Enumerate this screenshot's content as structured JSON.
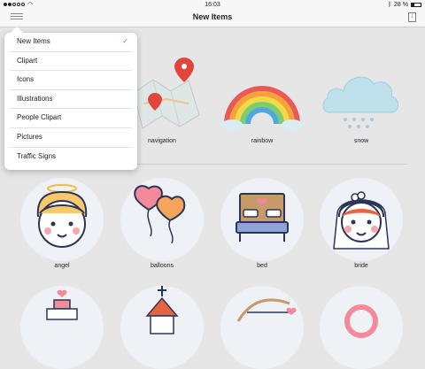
{
  "status_bar": {
    "time": "16:03",
    "battery": "28 %"
  },
  "nav": {
    "title": "New Items"
  },
  "dropdown": {
    "selected": "New Items",
    "items": [
      "New Items",
      "Clipart",
      "Icons",
      "Illustrations",
      "People Clipart",
      "Pictures",
      "Traffic Signs"
    ]
  },
  "grid": {
    "row1": [
      "navigation",
      "rainbow",
      "snow"
    ],
    "row2": [
      "angel",
      "balloons",
      "bed",
      "bride"
    ]
  },
  "colors": {
    "accent": "#3b7dd8",
    "pink": "#f28a9b",
    "navy": "#2b3558"
  }
}
